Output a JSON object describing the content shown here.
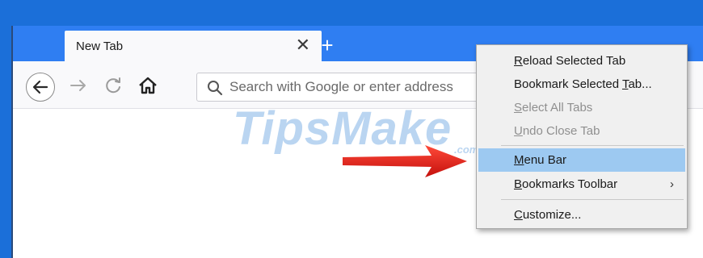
{
  "browser": {
    "tab_title": "New Tab",
    "tab_close_glyph": "✕",
    "new_tab_glyph": "+",
    "url_placeholder": "Search with Google or enter address"
  },
  "icons": {
    "back": "arrow-left-icon",
    "forward": "arrow-right-icon",
    "reload": "reload-icon",
    "home": "home-icon",
    "search": "search-icon"
  },
  "watermark": {
    "text": "TipsMake",
    "suffix": ".com"
  },
  "context_menu": {
    "items": [
      {
        "label": "Reload Selected Tab",
        "accesskey": "R",
        "enabled": true
      },
      {
        "label": "Bookmark Selected Tab...",
        "accesskey": "T",
        "enabled": true
      },
      {
        "label": "Select All Tabs",
        "accesskey": "S",
        "enabled": false
      },
      {
        "label": "Undo Close Tab",
        "accesskey": "U",
        "enabled": false
      },
      {
        "label": "Menu Bar",
        "accesskey": "M",
        "enabled": true,
        "highlighted": true
      },
      {
        "label": "Bookmarks Toolbar",
        "accesskey": "B",
        "enabled": true,
        "submenu": true
      },
      {
        "label": "Customize...",
        "accesskey": "C",
        "enabled": true
      }
    ],
    "submenu_glyph": "›"
  },
  "colors": {
    "tabstrip": "#2f7ef2",
    "desktop": "#1b6fd9",
    "menu_highlight": "#9dc9f1",
    "arrow": "#e0201c"
  }
}
